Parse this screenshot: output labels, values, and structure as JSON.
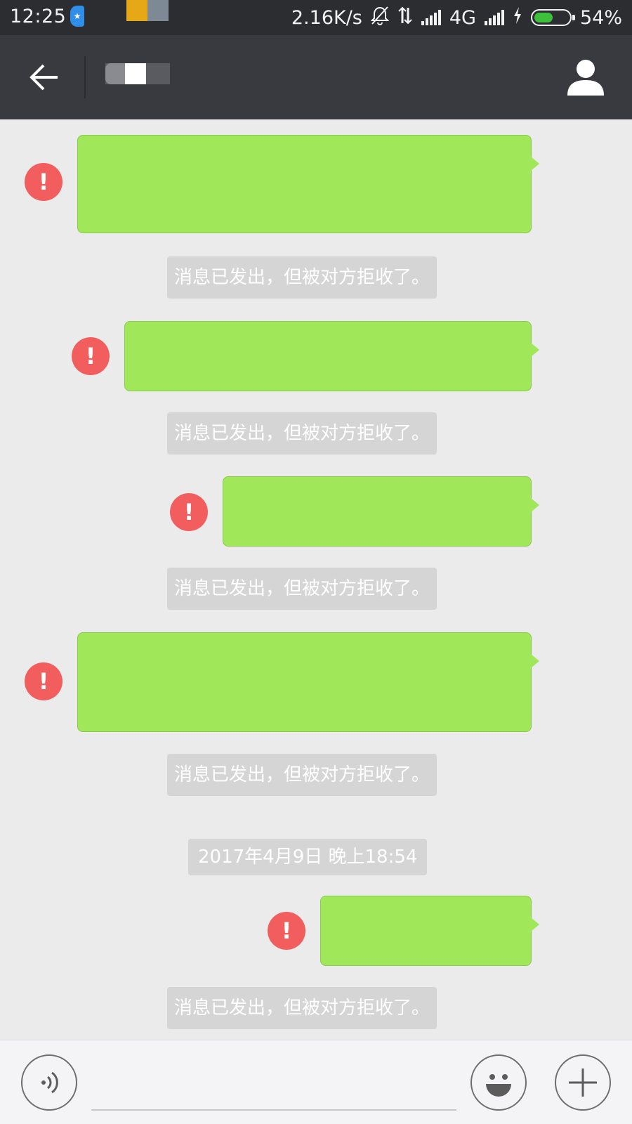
{
  "status_bar": {
    "time": "12:25",
    "net_speed": "2.16K/s",
    "network_type": "4G",
    "battery_percent": "54%",
    "battery_level": 0.54
  },
  "header": {
    "back_icon": "arrow-left-icon",
    "profile_icon": "person-icon"
  },
  "messages": [
    {
      "rejected_notice": "消息已发出，但被对方拒收了。"
    },
    {
      "rejected_notice": "消息已发出，但被对方拒收了。"
    },
    {
      "rejected_notice": "消息已发出，但被对方拒收了。"
    },
    {
      "rejected_notice": "消息已发出，但被对方拒收了。"
    },
    {
      "rejected_notice": "消息已发出，但被对方拒收了。"
    }
  ],
  "timestamp": "2017年4月9日 晚上18:54",
  "input_bar": {
    "voice_icon": "voice-icon",
    "emoji_icon": "emoji-icon",
    "more_icon": "plus-icon"
  },
  "colors": {
    "bubble": "#a0e75a",
    "error": "#f25e5e",
    "title_bar": "#393a3f",
    "notice_bg": "#d5d5d5"
  }
}
